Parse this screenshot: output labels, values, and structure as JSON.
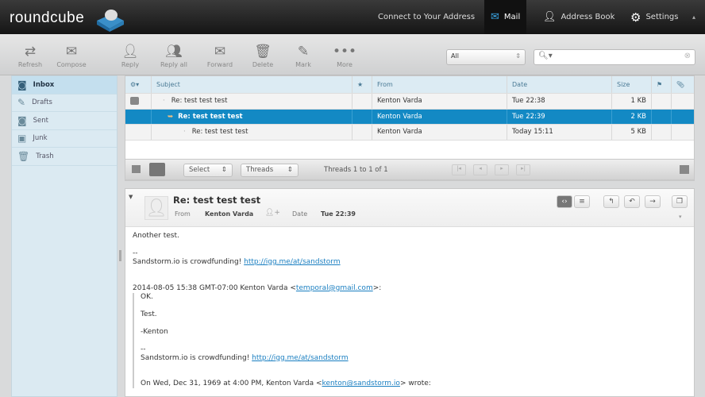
{
  "app": {
    "logo": "roundcube"
  },
  "nav": {
    "connect": "Connect to Your Address",
    "mail": "Mail",
    "address_book": "Address Book",
    "settings": "Settings"
  },
  "toolbar": {
    "refresh": "Refresh",
    "compose": "Compose",
    "reply": "Reply",
    "reply_all": "Reply all",
    "forward": "Forward",
    "delete": "Delete",
    "mark": "Mark",
    "more": "More"
  },
  "search": {
    "filter": "All",
    "placeholder": ""
  },
  "folders": [
    {
      "label": "Inbox"
    },
    {
      "label": "Drafts"
    },
    {
      "label": "Sent"
    },
    {
      "label": "Junk"
    },
    {
      "label": "Trash"
    }
  ],
  "list": {
    "columns": {
      "subject": "Subject",
      "from": "From",
      "date": "Date",
      "size": "Size"
    },
    "rows": [
      {
        "subject": "Re: test test test",
        "from": "Kenton Varda",
        "date": "Tue 22:38",
        "size": "1 KB"
      },
      {
        "subject": "Re: test test test",
        "from": "Kenton Varda",
        "date": "Tue 22:39",
        "size": "2 KB"
      },
      {
        "subject": "Re: test test test",
        "from": "Kenton Varda",
        "date": "Today 15:11",
        "size": "5 KB"
      }
    ],
    "footer": {
      "select": "Select",
      "threads": "Threads",
      "count": "Threads 1 to 1 of 1"
    }
  },
  "message": {
    "subject": "Re: test test test",
    "from_label": "From",
    "from": "Kenton Varda",
    "date_label": "Date",
    "date": "Tue 22:39",
    "body": {
      "line1": "Another test.",
      "sig_dash": "--",
      "sig_text": "Sandstorm.io is crowdfunding! ",
      "sig_link": "http://igg.me/at/sandstorm",
      "attrib": "2014-08-05 15:38 GMT-07:00 Kenton Varda <",
      "attrib_email": "temporal@gmail.com",
      "attrib_end": ">:",
      "q1": "OK.",
      "q2": "Test.",
      "q3": "-Kenton",
      "q_dash": "--",
      "q_sig_text": "Sandstorm.io is crowdfunding! ",
      "q_sig_link": "http://igg.me/at/sandstorm",
      "q_attrib": "On Wed, Dec 31, 1969 at 4:00 PM, Kenton Varda <",
      "q_attrib_email": "kenton@sandstorm.io",
      "q_attrib_end": "> wrote:"
    }
  }
}
